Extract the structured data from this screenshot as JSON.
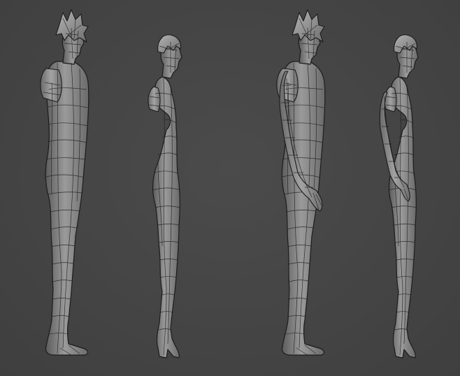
{
  "viewport": {
    "background": "#454545",
    "mesh_color": "#8a8a8a",
    "wire_color": "#1e1e1e"
  },
  "figures": [
    {
      "name": "male-base-mesh",
      "variant": "male",
      "arms": "stub"
    },
    {
      "name": "female-base-mesh",
      "variant": "female",
      "arms": "stub"
    },
    {
      "name": "male-full-mesh",
      "variant": "male",
      "arms": "full"
    },
    {
      "name": "female-full-mesh",
      "variant": "female",
      "arms": "full"
    }
  ]
}
